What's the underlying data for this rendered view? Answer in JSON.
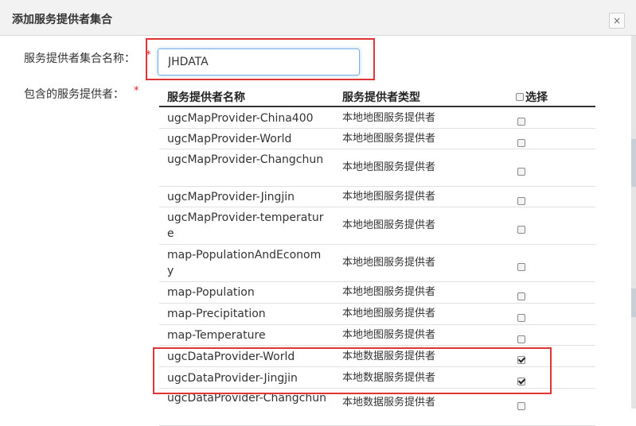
{
  "dialog": {
    "title": "添加服务提供者集合",
    "close_label": "×"
  },
  "form": {
    "name_label": "服务提供者集合名称：",
    "name_value": "JHDATA",
    "providers_label": "包含的服务提供者：",
    "required_mark": "*"
  },
  "table": {
    "headers": {
      "name": "服务提供者名称",
      "type": "服务提供者类型",
      "select": "选择"
    },
    "rows": [
      {
        "name": "ugcMapProvider-China400",
        "type": "本地地图服务提供者",
        "checked": false
      },
      {
        "name": "ugcMapProvider-World",
        "type": "本地地图服务提供者",
        "checked": false
      },
      {
        "name": "ugcMapProvider-Changchun",
        "type": "本地地图服务提供者",
        "checked": false
      },
      {
        "name": "ugcMapProvider-Jingjin",
        "type": "本地地图服务提供者",
        "checked": false
      },
      {
        "name": "ugcMapProvider-temperature",
        "type": "本地地图服务提供者",
        "checked": false
      },
      {
        "name": "map-PopulationAndEconomy",
        "type": "本地地图服务提供者",
        "checked": false
      },
      {
        "name": "map-Population",
        "type": "本地地图服务提供者",
        "checked": false
      },
      {
        "name": "map-Precipitation",
        "type": "本地地图服务提供者",
        "checked": false
      },
      {
        "name": "map-Temperature",
        "type": "本地地图服务提供者",
        "checked": false
      },
      {
        "name": "ugcDataProvider-World",
        "type": "本地数据服务提供者",
        "checked": true
      },
      {
        "name": "ugcDataProvider-Jingjin",
        "type": "本地数据服务提供者",
        "checked": true
      },
      {
        "name": "ugcDataProvider-Changchun",
        "type": "本地数据服务提供者",
        "checked": false
      }
    ]
  }
}
